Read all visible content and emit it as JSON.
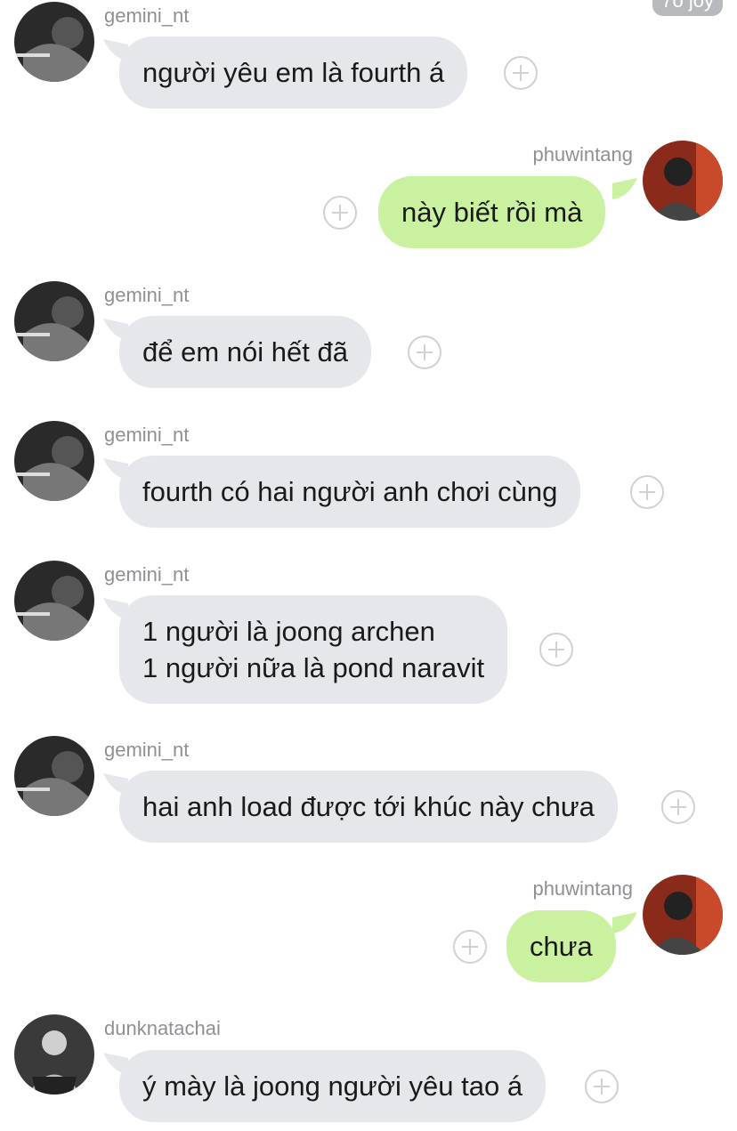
{
  "corner_badge": "7ó joy",
  "messages": [
    {
      "sender": "gemini_nt",
      "text": "người yêu em là fourth á"
    },
    {
      "sender": "phuwintang",
      "text": "này biết rồi mà"
    },
    {
      "sender": "gemini_nt",
      "text": "để em nói hết đã"
    },
    {
      "sender": "gemini_nt",
      "text": "fourth có hai người anh chơi cùng"
    },
    {
      "sender": "gemini_nt",
      "text_line1": "1 người là joong archen",
      "text_line2": "1 người nữa là pond naravit"
    },
    {
      "sender": "gemini_nt",
      "text": "hai anh load được tới khúc này chưa"
    },
    {
      "sender": "phuwintang",
      "text": "chưa"
    },
    {
      "sender": "dunknatachai",
      "text": "ý mày là joong người yêu tao á"
    }
  ],
  "colors": {
    "incoming_bubble": "#e5e7ea",
    "outgoing_bubble": "#c9f1a0",
    "username": "#8e9093"
  },
  "icons": {
    "add_reaction": "plus-circle-icon"
  }
}
